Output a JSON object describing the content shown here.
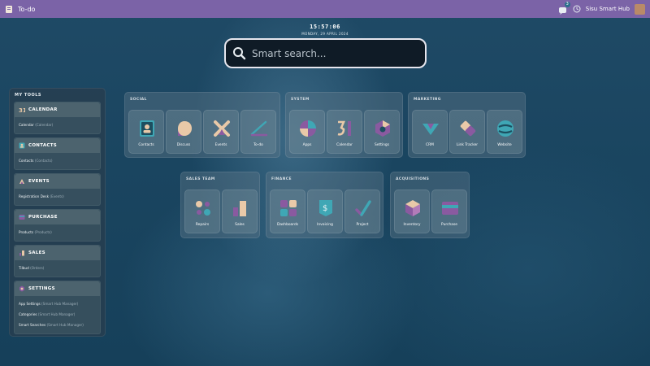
{
  "topbar": {
    "app_title": "To-do",
    "badge_count": "3",
    "company": "Sisu Smart Hub"
  },
  "clock": {
    "time": "15:57:06",
    "date": "MONDAY, 29 APRIL 2024"
  },
  "search": {
    "placeholder": "Smart search..."
  },
  "tools": {
    "title": "MY TOOLS",
    "sections": [
      {
        "label": "CALENDAR",
        "icon": "calendar-icon",
        "items": [
          {
            "name": "Calendar",
            "module": "(Calendar)"
          }
        ]
      },
      {
        "label": "CONTACTS",
        "icon": "contacts-icon",
        "items": [
          {
            "name": "Contacts",
            "module": "(Contacts)"
          }
        ]
      },
      {
        "label": "EVENTS",
        "icon": "events-icon",
        "items": [
          {
            "name": "Registration Desk",
            "module": "(Events)"
          }
        ]
      },
      {
        "label": "PURCHASE",
        "icon": "purchase-icon",
        "items": [
          {
            "name": "Products",
            "module": "(Products)"
          }
        ]
      },
      {
        "label": "SALES",
        "icon": "sales-icon",
        "items": [
          {
            "name": "Tilbud",
            "module": "(Orders)"
          }
        ]
      },
      {
        "label": "SETTINGS",
        "icon": "settings-icon",
        "items": [
          {
            "name": "App Settings",
            "module": "(Smart Hub Manager)"
          },
          {
            "name": "Categories",
            "module": "(Smart Hub Manager)"
          },
          {
            "name": "Smart Searches",
            "module": "(Smart Hub Manager)"
          }
        ]
      }
    ]
  },
  "groups": {
    "social": {
      "title": "SOCIAL",
      "apps": [
        "Contacts",
        "Discuss",
        "Events",
        "To-do"
      ]
    },
    "system": {
      "title": "SYSTEM",
      "apps": [
        "Apps",
        "Calendar",
        "Settings"
      ]
    },
    "marketing": {
      "title": "MARKETING",
      "apps": [
        "CRM",
        "Link Tracker",
        "Website"
      ]
    },
    "sales_team": {
      "title": "SALES TEAM",
      "apps": [
        "Repairs",
        "Sales"
      ]
    },
    "finance": {
      "title": "FINANCE",
      "apps": [
        "Dashboards",
        "Invoicing",
        "Project"
      ]
    },
    "acquisitions": {
      "title": "ACQUISITIONS",
      "apps": [
        "Inventory",
        "Purchase"
      ]
    }
  },
  "colors": {
    "topbar": "#7b63a7",
    "accent_teal": "#3fa7b5",
    "accent_purple": "#8a5aa0",
    "accent_peach": "#e9c9a8"
  }
}
